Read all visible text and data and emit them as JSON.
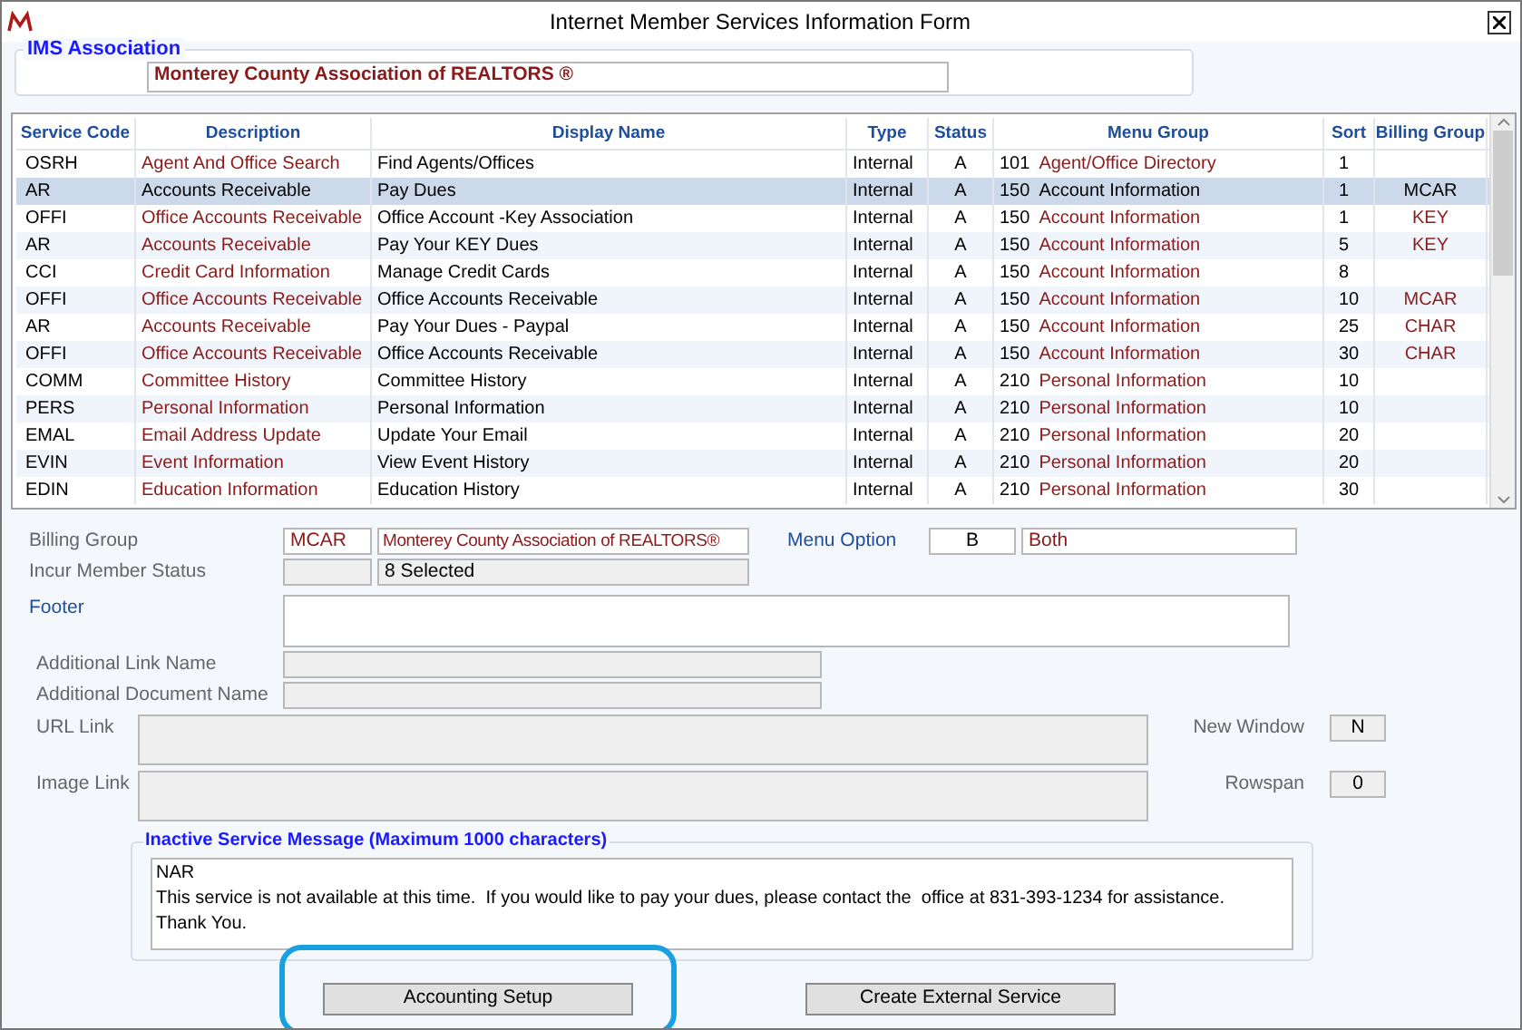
{
  "window": {
    "title": "Internet Member Services Information Form"
  },
  "association": {
    "legend": "IMS Association",
    "value": "Monterey County Association of REALTORS ®"
  },
  "table": {
    "columns": [
      "Service Code",
      "Description",
      "Display Name",
      "Type",
      "Status",
      "Menu Group",
      "Sort",
      "Billing Group"
    ],
    "rows": [
      {
        "code": "OSRH",
        "description": "Agent And Office Search",
        "display": "Find Agents/Offices",
        "type": "Internal",
        "status": "A",
        "menu_code": "101",
        "menu_name": "Agent/Office Directory",
        "sort": "1",
        "billing": "",
        "selected": false
      },
      {
        "code": "AR",
        "description": "Accounts Receivable",
        "display": "Pay Dues",
        "type": "Internal",
        "status": "A",
        "menu_code": "150",
        "menu_name": "Account Information",
        "sort": "1",
        "billing": "MCAR",
        "selected": true
      },
      {
        "code": "OFFI",
        "description": "Office Accounts Receivable",
        "display": "Office Account -Key Association",
        "type": "Internal",
        "status": "A",
        "menu_code": "150",
        "menu_name": "Account Information",
        "sort": "1",
        "billing": "KEY",
        "selected": false
      },
      {
        "code": "AR",
        "description": "Accounts Receivable",
        "display": "Pay Your KEY Dues",
        "type": "Internal",
        "status": "A",
        "menu_code": "150",
        "menu_name": "Account Information",
        "sort": "5",
        "billing": "KEY",
        "selected": false
      },
      {
        "code": "CCI",
        "description": "Credit Card Information",
        "display": "Manage Credit Cards",
        "type": "Internal",
        "status": "A",
        "menu_code": "150",
        "menu_name": "Account Information",
        "sort": "8",
        "billing": "",
        "selected": false
      },
      {
        "code": "OFFI",
        "description": "Office Accounts Receivable",
        "display": "Office Accounts Receivable",
        "type": "Internal",
        "status": "A",
        "menu_code": "150",
        "menu_name": "Account Information",
        "sort": "10",
        "billing": "MCAR",
        "selected": false
      },
      {
        "code": "AR",
        "description": "Accounts Receivable",
        "display": "Pay Your Dues - Paypal",
        "type": "Internal",
        "status": "A",
        "menu_code": "150",
        "menu_name": "Account Information",
        "sort": "25",
        "billing": "CHAR",
        "selected": false
      },
      {
        "code": "OFFI",
        "description": "Office Accounts Receivable",
        "display": "Office Accounts Receivable",
        "type": "Internal",
        "status": "A",
        "menu_code": "150",
        "menu_name": "Account Information",
        "sort": "30",
        "billing": "CHAR",
        "selected": false
      },
      {
        "code": "COMM",
        "description": "Committee History",
        "display": "Committee History",
        "type": "Internal",
        "status": "A",
        "menu_code": "210",
        "menu_name": "Personal Information",
        "sort": "10",
        "billing": "",
        "selected": false
      },
      {
        "code": "PERS",
        "description": "Personal Information",
        "display": "Personal Information",
        "type": "Internal",
        "status": "A",
        "menu_code": "210",
        "menu_name": "Personal Information",
        "sort": "10",
        "billing": "",
        "selected": false
      },
      {
        "code": "EMAL",
        "description": "Email Address Update",
        "display": "Update Your Email",
        "type": "Internal",
        "status": "A",
        "menu_code": "210",
        "menu_name": "Personal Information",
        "sort": "20",
        "billing": "",
        "selected": false
      },
      {
        "code": "EVIN",
        "description": "Event Information",
        "display": "View Event History",
        "type": "Internal",
        "status": "A",
        "menu_code": "210",
        "menu_name": "Personal Information",
        "sort": "20",
        "billing": "",
        "selected": false
      },
      {
        "code": "EDIN",
        "description": "Education Information",
        "display": "Education History",
        "type": "Internal",
        "status": "A",
        "menu_code": "210",
        "menu_name": "Personal Information",
        "sort": "30",
        "billing": "",
        "selected": false
      }
    ]
  },
  "form": {
    "billing_group": {
      "label": "Billing Group",
      "code": "MCAR",
      "name": "Monterey County Association of REALTORS®"
    },
    "menu_option": {
      "label": "Menu Option",
      "code": "B",
      "name": "Both"
    },
    "incur_member_status": {
      "label": "Incur Member Status",
      "value": "8 Selected"
    },
    "footer": {
      "label": "Footer"
    },
    "additional_link_name": {
      "label": "Additional Link Name"
    },
    "additional_document_name": {
      "label": "Additional Document Name"
    },
    "url_link": {
      "label": "URL Link"
    },
    "image_link": {
      "label": "Image Link"
    },
    "new_window": {
      "label": "New Window",
      "value": "N"
    },
    "rowspan": {
      "label": "Rowspan",
      "value": "0"
    }
  },
  "inactive_message": {
    "legend": "Inactive Service Message (Maximum 1000 characters)",
    "lines": [
      "NAR",
      "This service is not available at this time.  If you would like to pay your dues, please contact the  office at 831-393-1234 for assistance.",
      "Thank You."
    ]
  },
  "buttons": [
    {
      "label": "Accounting Setup",
      "highlighted": true
    },
    {
      "label": "Create External Service",
      "highlighted": false
    }
  ]
}
